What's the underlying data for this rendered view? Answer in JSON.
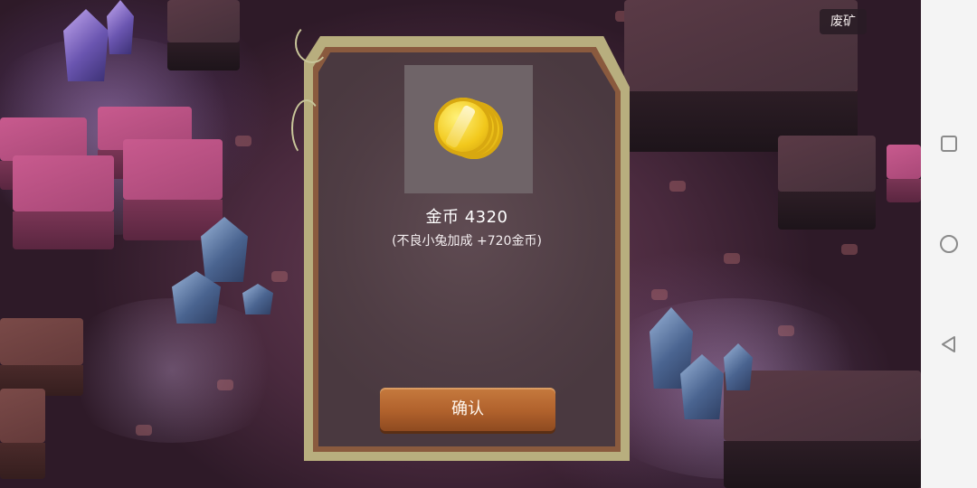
{
  "game": {
    "area_label": "废矿"
  },
  "reward_dialog": {
    "item_icon": "gold-coin-icon",
    "title": "金币 4320",
    "bonus": "(不良小兔加成 +720金币)",
    "confirm_label": "确认"
  },
  "navbar": {
    "buttons": [
      "recents-button",
      "home-button",
      "back-button"
    ]
  },
  "colors": {
    "dialog_frame": "#b8ae7e",
    "dialog_panel": "#4f3d44",
    "confirm_button": "#b0612c",
    "coin": "#f2c81c"
  }
}
